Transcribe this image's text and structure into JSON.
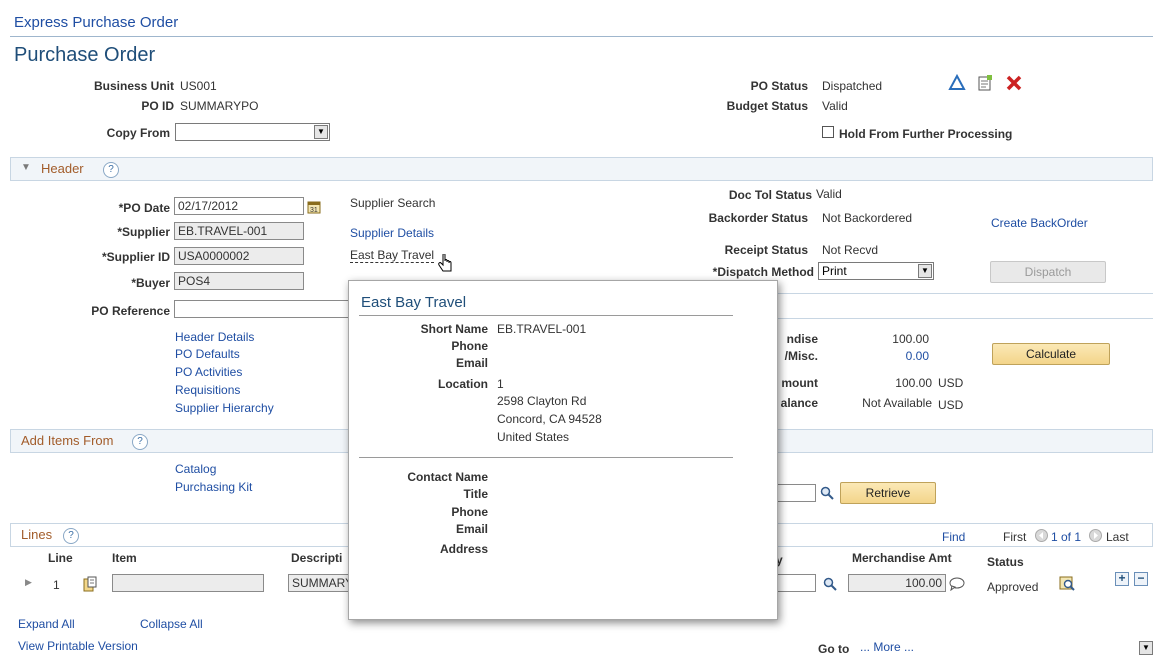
{
  "breadcrumb": "Express Purchase Order",
  "page_title": "Purchase Order",
  "top": {
    "business_unit_label": "Business Unit",
    "business_unit_value": "US001",
    "po_id_label": "PO ID",
    "po_id_value": "SUMMARYPO",
    "copy_from_label": "Copy From",
    "copy_from_value": "",
    "po_status_label": "PO Status",
    "po_status_value": "Dispatched",
    "budget_status_label": "Budget Status",
    "budget_status_value": "Valid",
    "hold_label": "Hold From Further Processing"
  },
  "header": {
    "section_label": "Header",
    "help": "?",
    "po_date_label": "*PO Date",
    "po_date_value": "02/17/2012",
    "supplier_label": "*Supplier",
    "supplier_value": "EB.TRAVEL-001",
    "supplier_id_label": "*Supplier ID",
    "supplier_id_value": "USA0000002",
    "buyer_label": "*Buyer",
    "buyer_value": "POS4",
    "po_reference_label": "PO Reference",
    "po_reference_value": "",
    "supplier_search": "Supplier Search",
    "supplier_details": "Supplier Details",
    "supplier_name_link": "East Bay Travel",
    "doc_tol_label": "Doc Tol Status",
    "doc_tol_value": "Valid",
    "backorder_label": "Backorder Status",
    "backorder_value": "Not Backordered",
    "create_backorder": "Create BackOrder",
    "receipt_label": "Receipt Status",
    "receipt_value": "Not Recvd",
    "dispatch_method_label": "*Dispatch Method",
    "dispatch_method_value": "Print",
    "dispatch_button": "Dispatch"
  },
  "links": [
    "Header Details",
    "PO Defaults",
    "PO Activities",
    "Requisitions",
    "Supplier Hierarchy"
  ],
  "totals": {
    "merchandise_label": "ndise",
    "merchandise_value": "100.00",
    "misc_label": "/Misc.",
    "misc_value": "0.00",
    "amount_label": "mount",
    "amount_value": "100.00",
    "amount_currency": "USD",
    "balance_label": "alance",
    "balance_value": "Not Available",
    "balance_currency": "USD",
    "calculate_button": "Calculate"
  },
  "add_items": {
    "section_label": "Add Items From",
    "help": "?",
    "catalog": "Catalog",
    "purchasing_kit": "Purchasing Kit",
    "retrieve_button": "Retrieve"
  },
  "lines": {
    "section_label": "Lines",
    "help": "?",
    "find": "Find",
    "first": "First",
    "pager": "1 of 1",
    "last": "Last",
    "col_line": "Line",
    "col_item": "Item",
    "col_description": "Descripti",
    "col_qty": "y",
    "col_merch": "Merchandise Amt",
    "col_status": "Status",
    "row_line": "1",
    "row_item": "",
    "row_description": "SUMMARY",
    "row_merch": "100.00",
    "row_status": "Approved"
  },
  "footer": {
    "expand_all": "Expand All",
    "collapse_all": "Collapse All",
    "printable": "View Printable Version",
    "goto_label": "Go to",
    "more_link": "... More ..."
  },
  "popup": {
    "title": "East Bay Travel",
    "short_name_label": "Short Name",
    "short_name_value": "EB.TRAVEL-001",
    "phone_label": "Phone",
    "email_label": "Email",
    "location_label": "Location",
    "location_value": "1",
    "address_line1": "2598 Clayton Rd",
    "address_line2": "Concord, CA  94528",
    "address_line3": "United States",
    "contact_name_label": "Contact Name",
    "title_label": "Title",
    "contact_phone_label": "Phone",
    "contact_email_label": "Email",
    "address_label": "Address"
  },
  "colors": {
    "link": "#1f4ea3",
    "section_title": "#a25c2a",
    "delete_icon": "#cc2222",
    "triangle_icon": "#2a6ebb"
  }
}
